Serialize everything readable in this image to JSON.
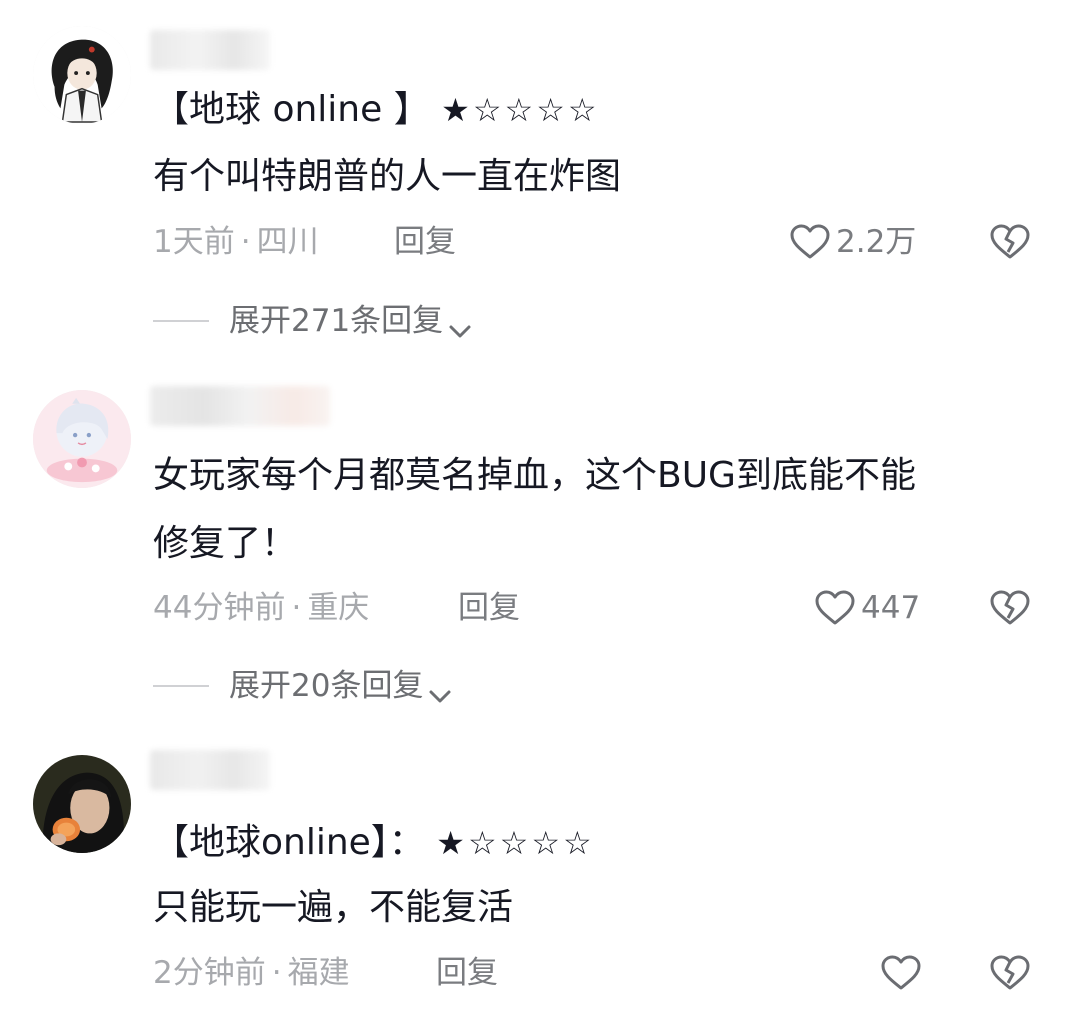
{
  "comments": [
    {
      "rating_prefix": "【地球 online 】",
      "stars": "★☆☆☆☆",
      "text_lines": [
        "有个叫特朗普的人一直在炸图"
      ],
      "time": "1天前",
      "location": "四川",
      "reply_label": "回复",
      "likes": "2.2万",
      "expand_label": "展开271条回复"
    },
    {
      "rating_prefix": "",
      "stars": "",
      "text_lines": [
        "女玩家每个月都莫名掉血，这个BUG到底能不能",
        "修复了！"
      ],
      "time": "44分钟前",
      "location": "重庆",
      "reply_label": "回复",
      "likes": "447",
      "expand_label": "展开20条回复"
    },
    {
      "rating_prefix": "【地球online】：",
      "stars": "★☆☆☆☆",
      "text_lines": [
        "只能玩一遍，不能复活"
      ],
      "time": "2分钟前",
      "location": "福建",
      "reply_label": "回复",
      "likes": "",
      "expand_label": ""
    }
  ],
  "separator_dot": "·",
  "icons": {
    "like": "heart-outline-icon",
    "dislike": "broken-heart-icon",
    "expand": "chevron-down-icon"
  },
  "colors": {
    "text_primary": "#161823",
    "text_meta": "#a7a9ad",
    "text_secondary": "#7a7c80"
  }
}
